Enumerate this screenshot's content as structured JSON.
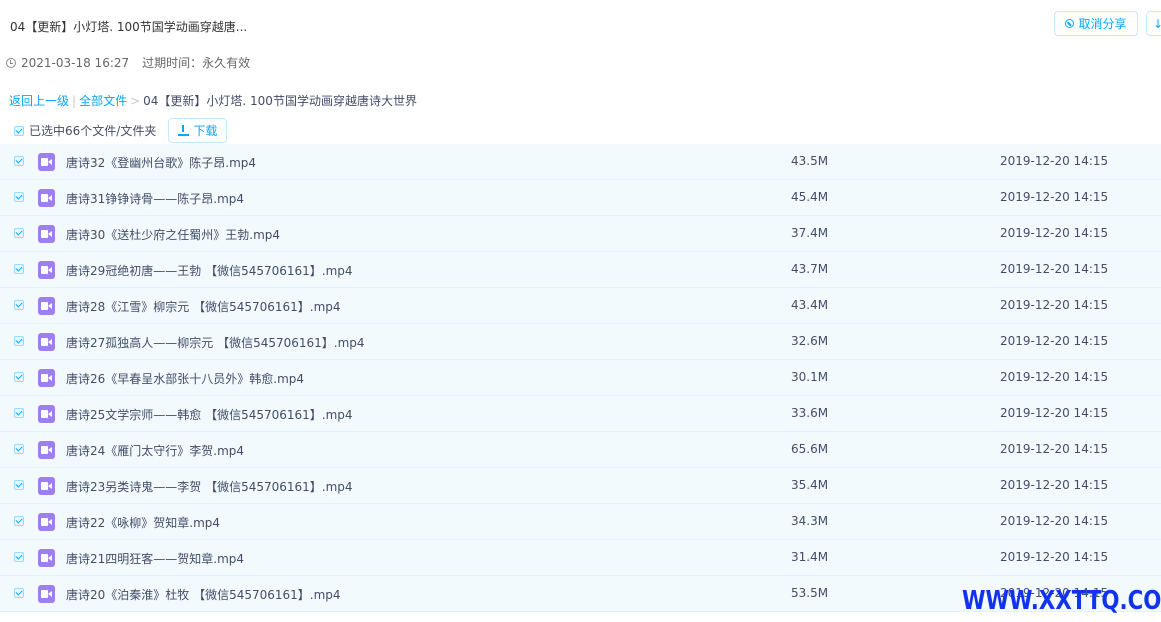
{
  "header": {
    "title": "04【更新】小灯塔. 100节国学动画穿越唐...",
    "cancel_share_label": "取消分享",
    "edge_button_label": "↓"
  },
  "meta": {
    "share_time": "2021-03-18 16:27",
    "expire_label": "过期时间：永久有效"
  },
  "breadcrumb": {
    "back": "返回上一级",
    "sep1": "|",
    "all_files": "全部文件",
    "sep2": ">",
    "current": "04【更新】小灯塔. 100节国学动画穿越唐诗大世界"
  },
  "selection": {
    "label": "已选中66个文件/文件夹",
    "download_label": "下载"
  },
  "files": [
    {
      "name": "唐诗32《登幽州台歌》陈子昂.mp4",
      "size": "43.5M",
      "date": "2019-12-20 14:15"
    },
    {
      "name": "唐诗31铮铮诗骨——陈子昂.mp4",
      "size": "45.4M",
      "date": "2019-12-20 14:15"
    },
    {
      "name": "唐诗30《送杜少府之任蜀州》王勃.mp4",
      "size": "37.4M",
      "date": "2019-12-20 14:15"
    },
    {
      "name": "唐诗29冠绝初唐——王勃 【微信545706161】.mp4",
      "size": "43.7M",
      "date": "2019-12-20 14:15"
    },
    {
      "name": "唐诗28《江雪》柳宗元 【微信545706161】.mp4",
      "size": "43.4M",
      "date": "2019-12-20 14:15"
    },
    {
      "name": "唐诗27孤独高人——柳宗元 【微信545706161】.mp4",
      "size": "32.6M",
      "date": "2019-12-20 14:15"
    },
    {
      "name": "唐诗26《早春呈水部张十八员外》韩愈.mp4",
      "size": "30.1M",
      "date": "2019-12-20 14:15"
    },
    {
      "name": "唐诗25文学宗师——韩愈 【微信545706161】.mp4",
      "size": "33.6M",
      "date": "2019-12-20 14:15"
    },
    {
      "name": "唐诗24《雁门太守行》李贺.mp4",
      "size": "65.6M",
      "date": "2019-12-20 14:15"
    },
    {
      "name": "唐诗23另类诗鬼——李贺 【微信545706161】.mp4",
      "size": "35.4M",
      "date": "2019-12-20 14:15"
    },
    {
      "name": "唐诗22《咏柳》贺知章.mp4",
      "size": "34.3M",
      "date": "2019-12-20 14:15"
    },
    {
      "name": "唐诗21四明狂客——贺知章.mp4",
      "size": "31.4M",
      "date": "2019-12-20 14:15"
    },
    {
      "name": "唐诗20《泊秦淮》杜牧 【微信545706161】.mp4",
      "size": "53.5M",
      "date": "2019-12-20 14:15"
    }
  ],
  "watermark": "WWW.XXTTQ.COM"
}
